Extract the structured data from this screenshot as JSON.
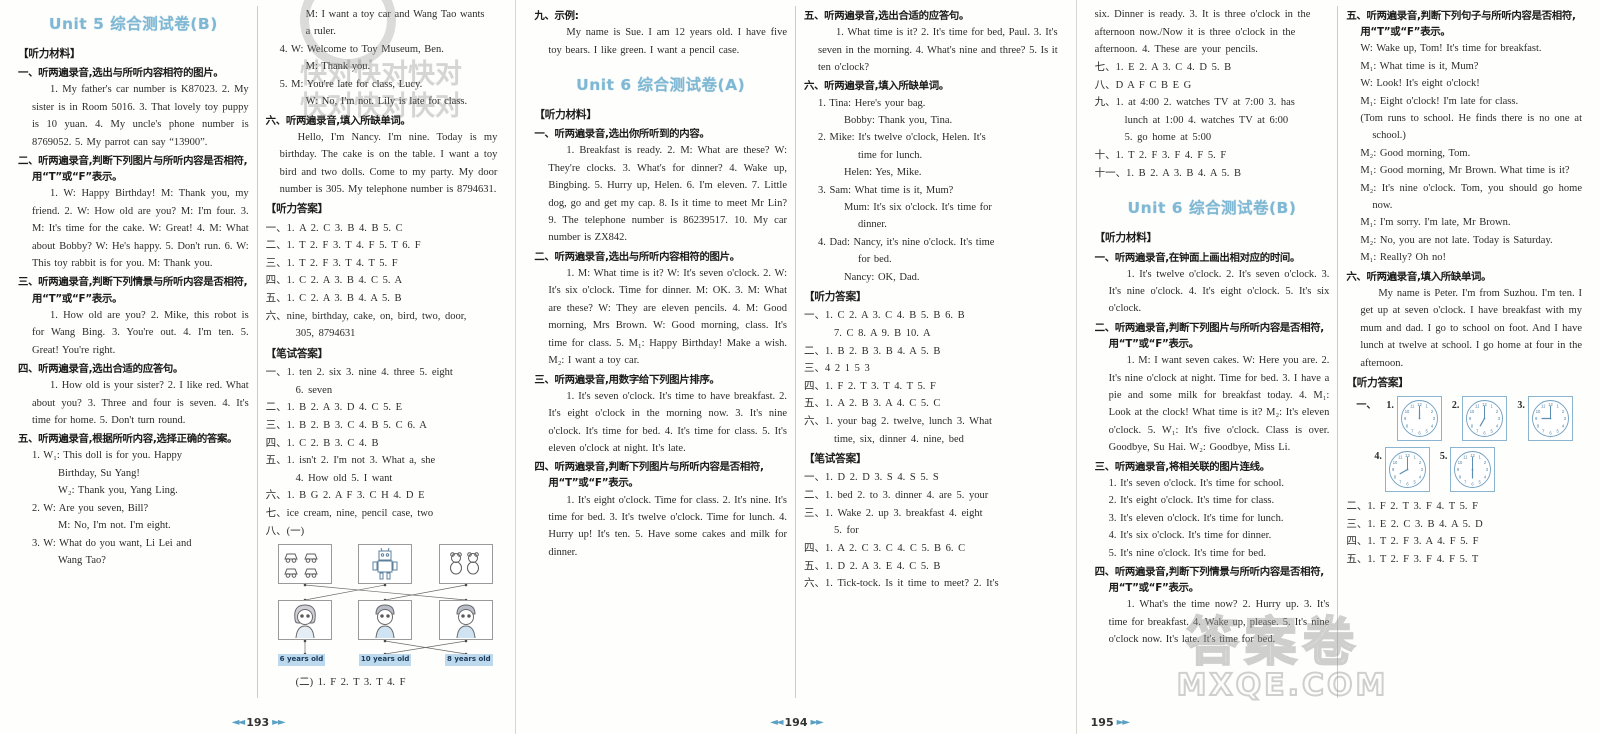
{
  "page": {
    "left_page_number": "193",
    "center_page_number": "194",
    "right_page_number": "195",
    "accent_color": "#7fb8d4",
    "watermark_primary": "快对快对快对",
    "watermark_secondary": "快对快对快对",
    "watermark_outline_cn": "答案卷",
    "watermark_outline_en": "MXQE.COM"
  },
  "unit5b": {
    "title": "Unit 5 综合测试卷(B)",
    "listening_material_head": "【听力材料】",
    "q1_head": "一、听两遍录音,选出与所听内容相符的图片。",
    "q1_body": "1. My father's car number is K87023. 2. My sister is in Room 5016. 3. That lovely toy puppy is 10 yuan. 4. My uncle's phone number is 8769052. 5. My parrot can say “13900”.",
    "q2_head": "二、听两遍录音,判断下列图片与所听内容是否相符,用“T”或“F”表示。",
    "q2_body": "1. W: Happy Birthday! M: Thank you, my friend. 2. W: How old are you? M: I'm four. 3. M: It's time for the cake. W: Great! 4. M: What about Bobby? W: He's happy. 5. Don't run. 6. W: This toy rabbit is for you. M: Thank you.",
    "q3_head": "三、听两遍录音,判断下列情景与所听内容是否相符,用“T”或“F”表示。",
    "q3_body": "1. How old are you? 2. Mike, this robot is for Wang Bing. 3. You're out. 4. I'm ten. 5. Great! You're right.",
    "q4_head": "四、听两遍录音,选出合适的应答句。",
    "q4_body": "1. How old is your sister? 2. I like red. What about you? 3. Three and four is seven. 4. It's time for home. 5. Don't turn round.",
    "q5_head": "五、听两遍录音,根据所听内容,选择正确的答案。",
    "q5_l1": "1. W₁: This doll is for you. Happy",
    "q5_l2": "Birthday, Su Yang!",
    "q5_l3": "W₂: Thank you, Yang Ling.",
    "q5_l4": "2. W: Are you seven, Bill?",
    "q5_l5": "M: No, I'm not. I'm eight.",
    "q5_l6": "3. W: What do you want, Li Lei and",
    "q5_l7": "Wang Tao?",
    "q5_l8": "M: I want a toy car and Wang Tao wants",
    "q5_l9": "a ruler.",
    "q5_l10": "4. W: Welcome to Toy Museum, Ben.",
    "q5_l11": "M: Thank you.",
    "q5_l12": "5. M: You're late for class, Lucy.",
    "q5_l13": "W: No, I'm not. Lily is late for class.",
    "q6_head": "六、听两遍录音,填入所缺单词。",
    "q6_body": "Hello, I'm Nancy. I'm nine. Today is my birthday. The cake is on the table. I want a toy bird and two dolls. Come to my party. My door number is 305. My telephone number is 8794631.",
    "listen_ans_head": "【听力答案】",
    "listen_answers": [
      "一、1. A  2. C  3. B  4. B  5. C",
      "二、1. T  2. F  3. T  4. F  5. T  6. F",
      "三、1. T  2. F  3. T  4. T  5. F",
      "四、1. C  2. A  3. B  4. C  5. A",
      "五、1. C  2. A  3. B  4. A  5. B",
      "六、nine, birthday, cake, on, bird, two, door,"
    ],
    "listen_answers_cont": "305, 8794631",
    "written_ans_head": "【笔试答案】",
    "written_answers": [
      "一、1. ten  2. six  3. nine  4. three  5. eight",
      "二、1. B  2. A  3. D  4. C  5. E",
      "三、1. B  2. B  3. C  4. B  5. C  6. A",
      "四、1. C  2. B  3. C  4. B",
      "五、1. isn't  2. I'm not  3. What a, she",
      "六、1. B G  2. A F  3. C H  4. D E",
      "七、ice cream, nine, pencil case, two",
      "八、(一)"
    ],
    "w1_cont": "6. seven",
    "w5_cont": "4. How old  5. I want",
    "match_labels": [
      "6 years old",
      "10 years old",
      "8 years old"
    ],
    "written_8_2": "(二) 1. F  2. T  3. T  4. F",
    "written_9_head": "九、示例:",
    "written_9_body": "My name is Sue. I am 12 years old. I have five toy bears. I like green. I want a pencil case."
  },
  "unit6a": {
    "title": "Unit 6 综合测试卷(A)",
    "listening_material_head": "【听力材料】",
    "q1_head": "一、听两遍录音,选出你所听到的内容。",
    "q1_body": "1. Breakfast is ready. 2. M: What are these? W: They're clocks. 3. What's for dinner? 4. Wake up, Bingbing. 5. Hurry up, Helen. 6. I'm eleven. 7. Little dog, go and get my cap. 8. Is it time to meet Mr Lin? 9. The telephone number is 86239517. 10. My car number is ZX842.",
    "q2_head": "二、听两遍录音,选出与所听内容相符的图片。",
    "q2_body": "1. M: What time is it? W: It's seven o'clock. 2. W: It's six o'clock. Time for dinner. M: OK. 3. M: What are these? W: They are eleven pencils. 4. M: Good morning, Mrs Brown. W: Good morning, class. It's time for class. 5. M₁: Happy Birthday! Make a wish. M₂: I want a toy car.",
    "q3_head": "三、听两遍录音,用数字给下列图片排序。",
    "q3_body": "1. It's seven o'clock. It's time to have breakfast. 2. It's eight o'clock in the morning now. 3. It's nine o'clock. It's time for bed. 4. It's time for class. 5. It's eleven o'clock at night. It's late.",
    "q4_head": "四、听两遍录音,判断下列图片与所听内容是否相符,用“T”或“F”表示。",
    "q4_body": "1. It's eight o'clock. Time for class. 2. It's nine. It's time for bed. 3. It's twelve o'clock. Time for lunch. 4. Hurry up! It's ten. 5. Have some cakes and milk for dinner.",
    "q5_head": "五、听两遍录音,选出合适的应答句。",
    "q5_body": "1. What time is it? 2. It's time for bed, Paul. 3. It's seven in the morning. 4. What's nine and three? 5. Is it ten o'clock?",
    "q6_head": "六、听两遍录音,填入所缺单词。",
    "q6_l1": "1. Tina: Here's your bag.",
    "q6_l2": "Bobby: Thank you, Tina.",
    "q6_l3": "2. Mike: It's twelve o'clock, Helen. It's",
    "q6_l4": "time for lunch.",
    "q6_l5": "Helen: Yes, Mike.",
    "q6_l6": "3. Sam: What time is it, Mum?",
    "q6_l7": "Mum: It's six o'clock. It's time for",
    "q6_l8": "dinner.",
    "q6_l9": "4. Dad: Nancy, it's nine o'clock. It's time",
    "q6_l10": "for bed.",
    "q6_l11": "Nancy: OK, Dad.",
    "listen_ans_head": "【听力答案】",
    "listen_answers": [
      "一、1. C  2. A  3. C  4. B  5. B  6. B",
      "二、1. B  2. B  3. B  4. A  5. B",
      "三、4  2  1  5  3",
      "四、1. F  2. T  3. T  4. T  5. F",
      "五、1. A  2. B  3. A  4. C  5. C",
      "六、1. your bag  2. twelve, lunch  3. What"
    ],
    "l1_cont": "7. C  8. A  9. B  10. A",
    "l6_cont": "time, six, dinner  4. nine, bed",
    "written_ans_head": "【笔试答案】",
    "written_answers": [
      "一、1. D  2. D  3. S  4. S  5. S",
      "二、1. bed  2. to  3. dinner  4. are  5. your",
      "三、1. Wake  2. up  3. breakfast  4. eight",
      "四、1. A  2. C  3. C  4. C  5. B  6. C",
      "五、1. D  2. A  3. E  4. C  5. B",
      "六、1. Tick-tock. Is it time to meet?  2. It's"
    ],
    "w3_cont": "5. for",
    "w6_cont": "six. Dinner is ready.  3. It is three o'clock in the afternoon now./Now it is three o'clock in the afternoon.  4. These are your pencils.",
    "written_answers2": [
      "七、1. E  2. A  3. C  4. D  5. B",
      "八、D  A  F  C  B  E  G",
      "九、1. at 4:00  2. watches TV at 7:00  3. has",
      "十、1. T  2. F  3. F  4. F  5. F",
      "十一、1. B  2. A  3. B  4. A  5. B"
    ],
    "w9_cont1": "lunch at 1:00  4. watches TV at 6:00",
    "w9_cont2": "5. go home at 5:00"
  },
  "unit6b": {
    "title": "Unit 6 综合测试卷(B)",
    "listening_material_head": "【听力材料】",
    "q1_head": "一、听两遍录音,在钟面上画出相对应的时间。",
    "q1_body": "1. It's twelve o'clock. 2. It's seven o'clock. 3. It's nine o'clock. 4. It's eight o'clock. 5. It's six o'clock.",
    "q2_head": "二、听两遍录音,判断下列图片与所听内容是否相符,用“T”或“F”表示。",
    "q2_body": "1. M: I want seven cakes. W: Here you are. 2. It's nine o'clock at night. Time for bed. 3. I have a pie and some milk for breakfast today. 4. M₁: Look at the clock! What time is it? M₂: It's eleven o'clock. 5. W₁: It's five o'clock. Class is over. Goodbye, Su Hai. W₂: Goodbye, Miss Li.",
    "q3_head": "三、听两遍录音,将相关联的图片连线。",
    "q3_l1": "1. It's seven o'clock. It's time for school.",
    "q3_l2": "2. It's eight o'clock. It's time for class.",
    "q3_l3": "3. It's eleven o'clock. It's time for lunch.",
    "q3_l4": "4. It's six o'clock. It's time for dinner.",
    "q3_l5": "5. It's nine o'clock. It's time for bed.",
    "q4_head": "四、听两遍录音,判断下列情景与所听内容是否相符,用“T”或“F”表示。",
    "q4_body": "1. What's the time now? 2. Hurry up. 3. It's time for breakfast. 4. Wake up, please. 5. It's nine o'clock now. It's late. It's time for bed.",
    "q5_head": "五、听两遍录音,判断下列句子与所听内容是否相符,用“T”或“F”表示。",
    "q5_l1": "W: Wake up, Tom! It's time for breakfast.",
    "q5_l2": "M₁: What time is it, Mum?",
    "q5_l3": "W: Look! It's eight o'clock!",
    "q5_l4": "M₁: Eight o'clock! I'm late for class.",
    "q5_l5": "(Tom runs to school. He finds there is no one at school.)",
    "q5_l6": "M₂: Good morning, Tom.",
    "q5_l7": "M₁: Good morning, Mr Brown. What time is it?",
    "q5_l8": "M₂: It's nine o'clock. Tom, you should go home now.",
    "q5_l9": "M₁: I'm sorry. I'm late, Mr Brown.",
    "q5_l10": "M₂: No, you are not late. Today is Saturday.",
    "q5_l11": "M₁: Really? Oh no!",
    "q6_head": "六、听两遍录音,填入所缺单词。",
    "q6_body": "My name is Peter. I'm from Suzhou. I'm ten. I get up at seven o'clock. I have breakfast with my mum and dad. I go to school on foot. And I have lunch at twelve at school. I go home at four in the afternoon.",
    "listen_ans_head": "【听力答案】",
    "listen_ans_1_label": "一、",
    "clocks": [
      {
        "no": "1.",
        "hour": 12,
        "minute": 0
      },
      {
        "no": "2.",
        "hour": 7,
        "minute": 0
      },
      {
        "no": "3.",
        "hour": 9,
        "minute": 0
      },
      {
        "no": "4.",
        "hour": 8,
        "minute": 0
      },
      {
        "no": "5.",
        "hour": 6,
        "minute": 0
      }
    ],
    "listen_answers": [
      "二、1. F  2. T  3. F  4. T  5. F",
      "三、1. E  2. C  3. B  4. A  5. D",
      "四、1. T  2. F  3. A  4. F  5. F",
      "五、1. T  2. F  3. F  4. F  5. T"
    ]
  }
}
